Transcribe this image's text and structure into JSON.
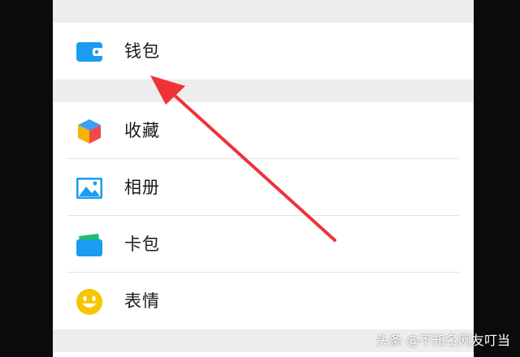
{
  "menu": {
    "wallet": {
      "label": "钱包",
      "icon": "wallet-icon",
      "color": "#1a9cf0"
    },
    "items": [
      {
        "label": "收藏",
        "icon": "favorites-cube-icon"
      },
      {
        "label": "相册",
        "icon": "album-icon"
      },
      {
        "label": "卡包",
        "icon": "card-wallet-icon"
      },
      {
        "label": "表情",
        "icon": "emoji-smile-icon"
      }
    ]
  },
  "annotation": {
    "arrow_color": "#ee3338"
  },
  "watermark": {
    "text": "头条 @不知名网友叮当"
  }
}
